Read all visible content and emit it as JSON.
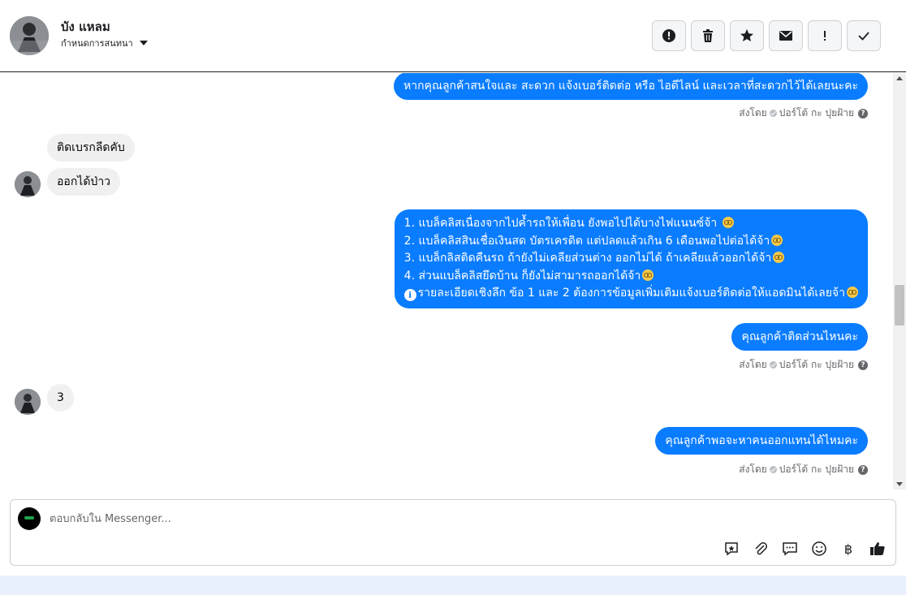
{
  "contact": {
    "name": "บัง แหลม",
    "assign_label": "กำหนดการสนทนา"
  },
  "toolbar": {
    "buttons": [
      {
        "icon": "alert-circle-icon",
        "action": "spam"
      },
      {
        "icon": "trash-icon",
        "action": "delete"
      },
      {
        "icon": "star-icon",
        "action": "follow-up"
      },
      {
        "icon": "envelope-icon",
        "action": "mark-unread"
      },
      {
        "icon": "exclamation-icon",
        "action": "priority"
      },
      {
        "icon": "check-icon",
        "action": "done"
      }
    ]
  },
  "messages": {
    "m1": {
      "direction": "out",
      "text": "หากคุณลูกค้าสนใจและ สะดวก แจ้งเบอร์ติดต่อ หรือ ไอดีไลน์ และเวลาที่สะดวกไว้ได้เลยนะคะ"
    },
    "meta1": {
      "prefix": "ส่งโดย",
      "sender": "ปอร์โต้ กะ ปุยฝ้าย"
    },
    "m2": {
      "direction": "in",
      "text": "ติดเบรกลีดคับ"
    },
    "m3": {
      "direction": "in",
      "text": "ออกได้ป่าว"
    },
    "m4": {
      "direction": "out",
      "lines": [
        "1. แบล็คลิสเนื่องจากไปค้ำรถให้เพื่อน ยังพอไปได้บางไฟแนนซ์จ้า",
        "2. แบล็คลิสสินเชื่อเงินสด บัตรเครดิต แต่ปลดแล้วเกิน 6 เดือนพอไปต่อได้จ้า",
        "3. แบล็กลิสติดคืนรถ ถ้ายังไม่เคลียส่วนต่าง ออกไม่ได้ ถ้าเคลียแล้วออกได้จ้า",
        "4. ส่วนแบล็คลิสยึดบ้าน ก็ยังไม่สามารถออกได้จ้า",
        "รายละเอียดเชิงลึก ข้อ 1 และ 2 ต้องการข้อมูลเพิ่มเติมแจ้งเบอร์ติดต่อให้แอดมินได้เลยจ้า"
      ]
    },
    "m5": {
      "direction": "out",
      "text": "คุณลูกค้าติดส่วนไหนคะ"
    },
    "meta5": {
      "prefix": "ส่งโดย",
      "sender": "ปอร์โต้ กะ ปุยฝ้าย"
    },
    "m6": {
      "direction": "in",
      "text": "3"
    },
    "m7": {
      "direction": "out",
      "text": "คุณลูกค้าพอจะหาคนออกแทนได้ไหมคะ"
    },
    "meta7": {
      "prefix": "ส่งโดย",
      "sender": "ปอร์โต้ กะ ปุยฝ้าย"
    }
  },
  "composer": {
    "placeholder": "ตอบกลับใน Messenger...",
    "value": "",
    "tools": [
      "saved-reply-icon",
      "attachment-icon",
      "chat-bubble-icon",
      "emoji-icon",
      "baht-icon",
      "thumbs-up-icon"
    ],
    "baht_glyph": "฿"
  },
  "colors": {
    "outgoing_bubble": "#0a7cff",
    "incoming_bubble": "#f0f0f0",
    "footer_band": "#e7f0fc"
  }
}
